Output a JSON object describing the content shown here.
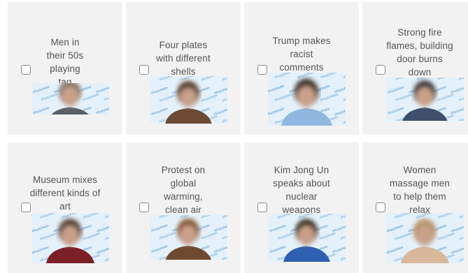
{
  "options": [
    {
      "label": "Men in their 50s playing tag",
      "shirt": "#5c6066",
      "hair": "#8a7a6a"
    },
    {
      "label": "Four plates with different shells",
      "shirt": "#6d4a34",
      "hair": "#5a3b28"
    },
    {
      "label": "Trump makes racist comments",
      "shirt": "#8fb7e0",
      "hair": "#3a2f28"
    },
    {
      "label": "Strong fire flames, building door burns down",
      "shirt": "#3d4f6b",
      "hair": "#3a3a3a"
    },
    {
      "label": "Museum mixes different kinds of art",
      "shirt": "#7a2026",
      "hair": "#5a4330"
    },
    {
      "label": "Protest on global warming, clean air",
      "shirt": "#6e4a30",
      "hair": "#8a5a38"
    },
    {
      "label": "Kim Jong Un speaks about nuclear weapons",
      "shirt": "#2f5fb0",
      "hair": "#3e3226"
    },
    {
      "label": "Women massage men to help them relax",
      "shirt": "#d8b89c",
      "hair": "#b8946c"
    }
  ],
  "backdrop_text": "#RadyMatte"
}
